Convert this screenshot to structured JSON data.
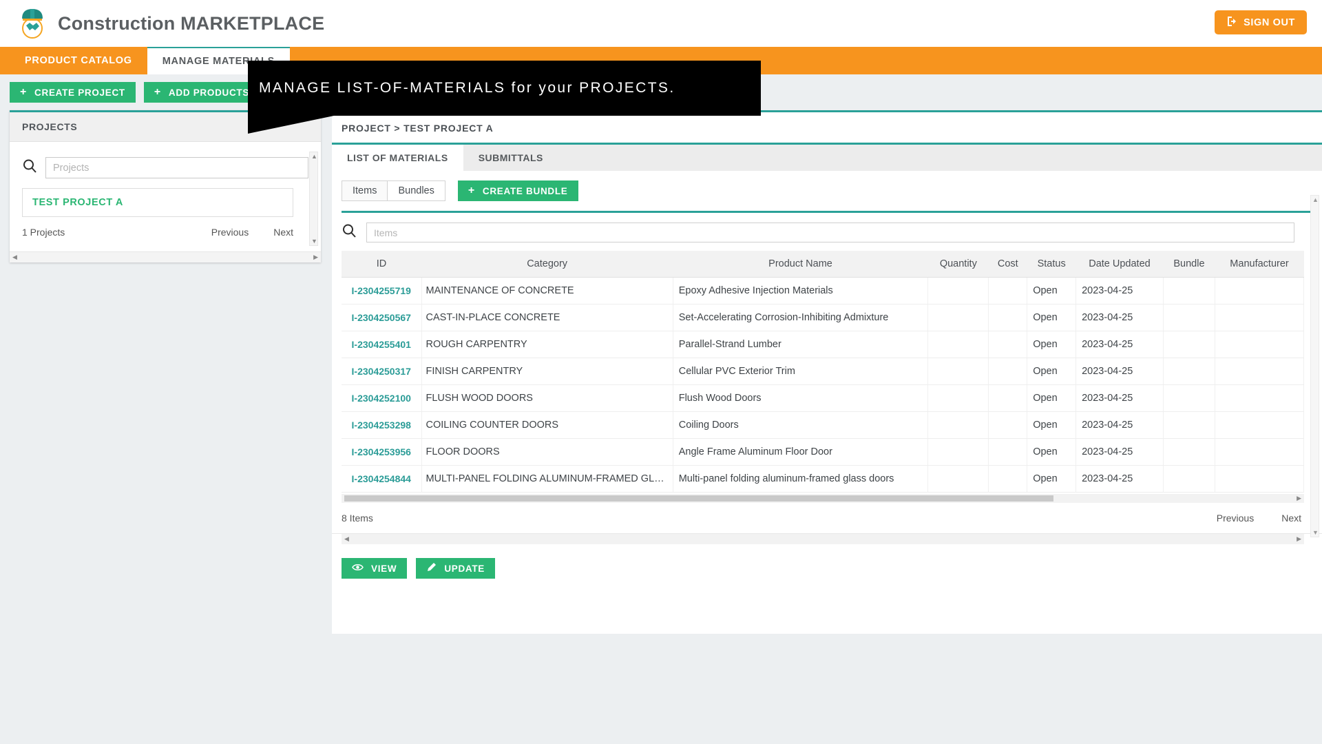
{
  "header": {
    "brand_prefix": "Construction ",
    "brand_suffix": "MARKETPLACE",
    "logo_icon": "hardhat-handshake-logo",
    "signout_label": "SIGN OUT",
    "signout_icon": "sign-out-icon",
    "signout_color": "#f7941e"
  },
  "nav": {
    "tabs": [
      {
        "label": "PRODUCT CATALOG",
        "active": false
      },
      {
        "label": "MANAGE MATERIALS",
        "active": true
      }
    ],
    "bar_color": "#f7941e"
  },
  "toolbar": {
    "create_project_label": "CREATE PROJECT",
    "add_products_label": "ADD PRODUCTS",
    "plus_icon": "plus-icon",
    "button_color": "#2bb673"
  },
  "tooltip": {
    "text": "MANAGE LIST-OF-MATERIALS for your PROJECTS.",
    "background": "#000000",
    "color": "#ffffff"
  },
  "sidebar": {
    "title": "PROJECTS",
    "search_placeholder": "Projects",
    "search_value": "",
    "search_icon": "search-icon",
    "projects": [
      {
        "name": "TEST PROJECT A"
      }
    ],
    "count_label": "1 Projects",
    "previous_label": "Previous",
    "next_label": "Next",
    "scroll_up_icon": "scroll-up-arrow-icon",
    "scroll_down_icon": "scroll-down-arrow-icon",
    "scroll_left_icon": "scroll-left-arrow-icon",
    "scroll_right_icon": "scroll-right-arrow-icon"
  },
  "main": {
    "breadcrumb": "PROJECT > TEST PROJECT A",
    "tabs": [
      {
        "label": "LIST OF MATERIALS",
        "active": true
      },
      {
        "label": "SUBMITTALS",
        "active": false
      }
    ],
    "segmented": [
      {
        "label": "Items",
        "active": true
      },
      {
        "label": "Bundles",
        "active": false
      }
    ],
    "create_bundle_label": "CREATE BUNDLE",
    "create_bundle_icon": "plus-icon",
    "item_search_placeholder": "Items",
    "item_search_value": "",
    "item_search_icon": "search-icon",
    "table": {
      "columns": [
        "ID",
        "Category",
        "Product Name",
        "Quantity",
        "Cost",
        "Status",
        "Date Updated",
        "Bundle",
        "Manufacturer"
      ],
      "rows": [
        {
          "id": "I-2304255719",
          "category": "MAINTENANCE OF CONCRETE",
          "product": "Epoxy Adhesive Injection Materials",
          "quantity": "",
          "cost": "",
          "status": "Open",
          "date": "2023-04-25",
          "bundle": "",
          "manufacturer": ""
        },
        {
          "id": "I-2304250567",
          "category": "CAST-IN-PLACE CONCRETE",
          "product": "Set-Accelerating Corrosion-Inhibiting Admixture",
          "quantity": "",
          "cost": "",
          "status": "Open",
          "date": "2023-04-25",
          "bundle": "",
          "manufacturer": ""
        },
        {
          "id": "I-2304255401",
          "category": "ROUGH CARPENTRY",
          "product": "Parallel-Strand Lumber",
          "quantity": "",
          "cost": "",
          "status": "Open",
          "date": "2023-04-25",
          "bundle": "",
          "manufacturer": ""
        },
        {
          "id": "I-2304250317",
          "category": "FINISH CARPENTRY",
          "product": "Cellular PVC Exterior Trim",
          "quantity": "",
          "cost": "",
          "status": "Open",
          "date": "2023-04-25",
          "bundle": "",
          "manufacturer": ""
        },
        {
          "id": "I-2304252100",
          "category": "FLUSH WOOD DOORS",
          "product": "Flush Wood Doors",
          "quantity": "",
          "cost": "",
          "status": "Open",
          "date": "2023-04-25",
          "bundle": "",
          "manufacturer": ""
        },
        {
          "id": "I-2304253298",
          "category": "COILING COUNTER DOORS",
          "product": "Coiling Doors",
          "quantity": "",
          "cost": "",
          "status": "Open",
          "date": "2023-04-25",
          "bundle": "",
          "manufacturer": ""
        },
        {
          "id": "I-2304253956",
          "category": "FLOOR DOORS",
          "product": "Angle Frame Aluminum Floor Door",
          "quantity": "",
          "cost": "",
          "status": "Open",
          "date": "2023-04-25",
          "bundle": "",
          "manufacturer": ""
        },
        {
          "id": "I-2304254844",
          "category": "MULTI-PANEL FOLDING ALUMINUM-FRAMED GLASS DOORS",
          "product": "Multi-panel folding aluminum-framed glass doors",
          "quantity": "",
          "cost": "",
          "status": "Open",
          "date": "2023-04-25",
          "bundle": "",
          "manufacturer": ""
        }
      ],
      "count_label": "8 Items",
      "previous_label": "Previous",
      "next_label": "Next"
    },
    "actions": [
      {
        "label": "VIEW",
        "icon": "eye-icon"
      },
      {
        "label": "UPDATE",
        "icon": "pencil-icon"
      }
    ]
  }
}
